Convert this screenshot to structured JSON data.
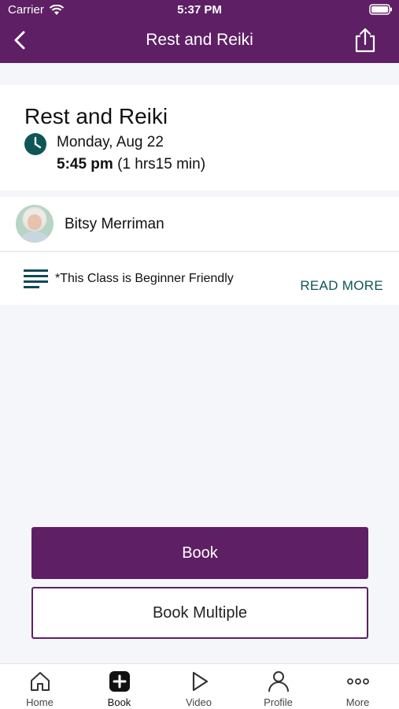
{
  "status_bar": {
    "carrier": "Carrier",
    "time": "5:37 PM"
  },
  "nav": {
    "title": "Rest and Reiki"
  },
  "class_info": {
    "title": "Rest and Reiki",
    "date": "Monday, Aug 22",
    "start_time": "5:45 pm",
    "duration": "(1 hrs15 min)"
  },
  "instructor": {
    "name": "Bitsy Merriman"
  },
  "description": {
    "text": "*This Class is Beginner Friendly",
    "read_more": "READ MORE"
  },
  "actions": {
    "book": "Book",
    "book_multiple": "Book Multiple"
  },
  "tabbar": {
    "items": [
      {
        "label": "Home",
        "icon": "home-icon"
      },
      {
        "label": "Book",
        "icon": "plus-square-icon"
      },
      {
        "label": "Video",
        "icon": "play-icon"
      },
      {
        "label": "Profile",
        "icon": "person-icon"
      },
      {
        "label": "More",
        "icon": "more-dots-icon"
      }
    ],
    "active": "Book"
  },
  "colors": {
    "brand": "#5e1f64",
    "accent": "#0e5656"
  }
}
